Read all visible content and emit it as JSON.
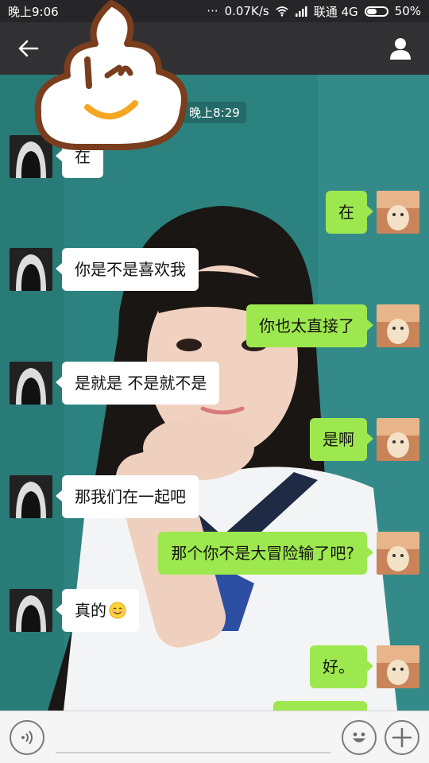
{
  "status_bar": {
    "time": "晚上9:06",
    "dots": "···",
    "speed": "0.07K/s",
    "carrier": "联通 4G",
    "battery_percent": "50%",
    "battery_level": 0.5
  },
  "title_bar": {
    "back_icon": "arrow-left-icon",
    "profile_icon": "person-icon"
  },
  "chat": {
    "timestamp": "晚上8:29",
    "messages": [
      {
        "side": "left",
        "text": "在"
      },
      {
        "side": "right",
        "text": "在"
      },
      {
        "side": "left",
        "text": "你是不是喜欢我"
      },
      {
        "side": "right",
        "text": "你也太直接了"
      },
      {
        "side": "left",
        "text": "是就是 不是就不是"
      },
      {
        "side": "right",
        "text": "是啊"
      },
      {
        "side": "left",
        "text": "那我们在一起吧"
      },
      {
        "side": "right",
        "text": "那个你不是大冒险输了吧?"
      },
      {
        "side": "left",
        "text": "真的",
        "emoji": "smiling-face-icon"
      },
      {
        "side": "right",
        "text": "好。"
      }
    ]
  },
  "input_bar": {
    "voice_icon": "voice-icon",
    "emoji_icon": "emoji-icon",
    "plus_icon": "plus-icon",
    "placeholder": ""
  },
  "colors": {
    "outgoing_bubble": "#9ee84f",
    "incoming_bubble": "#ffffff",
    "title_bar": "#313133",
    "background": "#2f8a86"
  }
}
